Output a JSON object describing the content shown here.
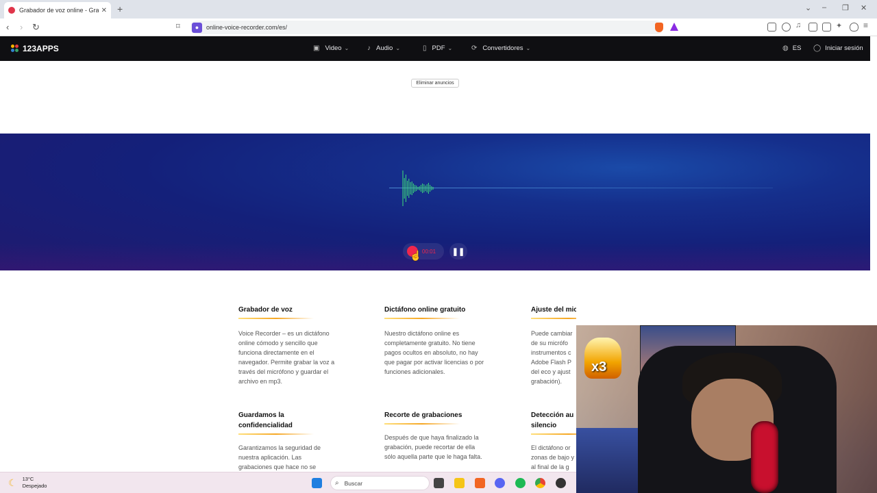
{
  "browser": {
    "tab_title": "Grabador de voz online - Gra",
    "url": "online-voice-recorder.com/es/"
  },
  "site": {
    "logo": "123APPS",
    "nav": [
      {
        "label": "Video",
        "icon": "video-icon"
      },
      {
        "label": "Audio",
        "icon": "music-note-icon"
      },
      {
        "label": "PDF",
        "icon": "document-icon"
      },
      {
        "label": "Convertidores",
        "icon": "convert-icon"
      }
    ],
    "language": "ES",
    "signin": "Iniciar sesión",
    "remove_ads": "Eliminar anuncios"
  },
  "recorder": {
    "timer": "00:01",
    "state": "recording"
  },
  "features": [
    {
      "title": "Grabador de voz",
      "text": "Voice Recorder – es un dictáfono online cómodo y sencillo que funciona directamente en el navegador. Permite grabar la voz a través del micrófono y guardar el archivo en mp3."
    },
    {
      "title": "Dictáfono online gratuito",
      "text": "Nuestro dictáfono online es completamente gratuito. No tiene pagos ocultos en absoluto, no hay que pagar por activar licencias o por funciones adicionales."
    },
    {
      "title": "Ajuste del micrófono",
      "text": "Puede cambiar de su micrófo instrumentos c Adobe Flash P del eco y ajust grabación)."
    },
    {
      "title": "Guardamos la confidencialidad",
      "text": "Garantizamos la seguridad de nuestra aplicación. Las grabaciones que hace no se"
    },
    {
      "title": "Recorte de grabaciones",
      "text": "Después de que haya finalizado la grabación, puede recortar de ella sólo aquella parte que le haga falta."
    },
    {
      "title": "Detección au silencio",
      "text": "El dictáfono or zonas de bajo y al final de la g"
    }
  ],
  "overlay": {
    "badge": "x3"
  },
  "taskbar": {
    "temperature": "13°C",
    "weather": "Despejado",
    "search_placeholder": "Buscar"
  },
  "colors": {
    "accent_record": "#f0264d",
    "nav_bg": "#0f0f12",
    "recorder_bg": "#14207a",
    "waveform": "#3ee07a"
  }
}
